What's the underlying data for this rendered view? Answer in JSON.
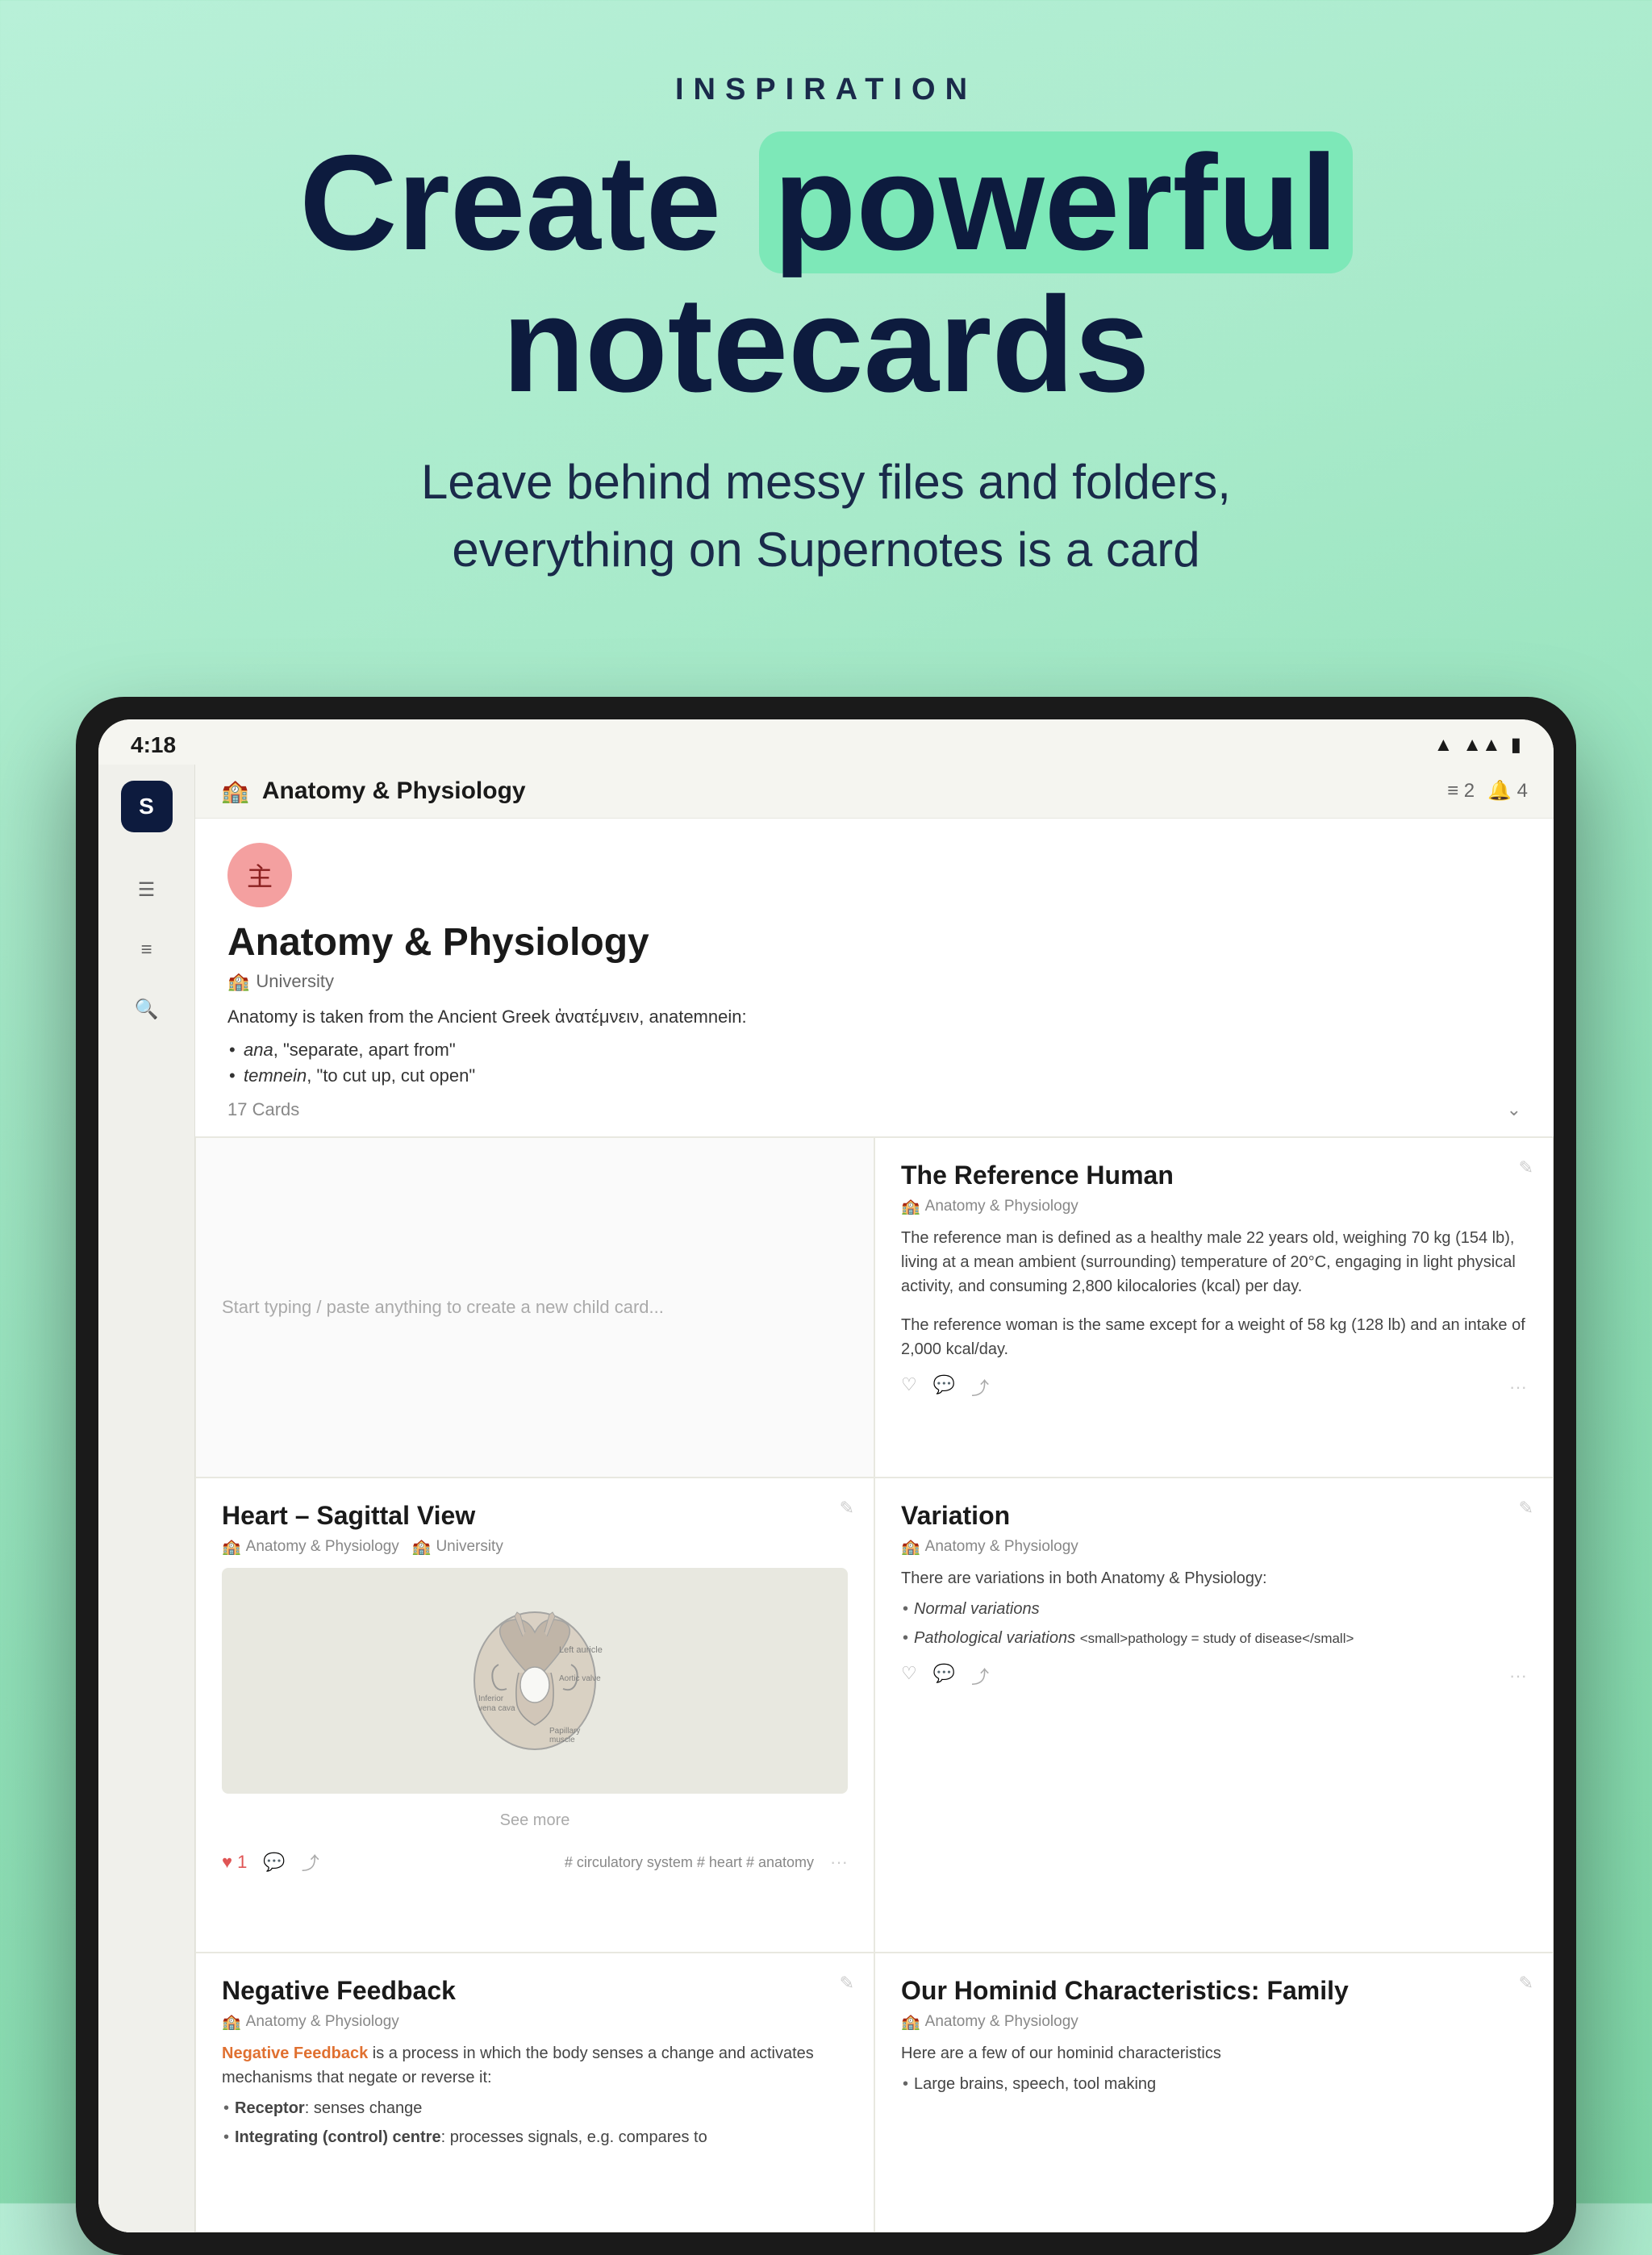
{
  "hero": {
    "inspiration": "INSPIRATION",
    "headline_start": "Create ",
    "headline_highlight": "powerful",
    "headline_end": "notecards",
    "subtitle_line1": "Leave behind messy files and folders,",
    "subtitle_line2": "everything on Supernotes is a card"
  },
  "status_bar": {
    "time": "4:18",
    "icons": "▶ ⬛ ⬛"
  },
  "top_bar": {
    "icon": "🏫",
    "title": "Anatomy & Physiology",
    "filter_count": "≡ 2",
    "bell_count": "🔔 4"
  },
  "card_header": {
    "avatar_icon": "主",
    "title": "Anatomy & Physiology",
    "subtitle": "University",
    "description": "Anatomy is taken from the Ancient Greek ἀνατέμνειν, anatemnein:",
    "bullets": [
      "ana, \"separate, apart from\"",
      "temnein, \"to cut up, cut open\""
    ],
    "cards_count": "17 Cards"
  },
  "cards": {
    "new_placeholder": "Start typing / paste anything to create a new child card...",
    "heart_card": {
      "title": "Heart – Sagittal View",
      "meta1": "Anatomy & Physiology",
      "meta2": "University",
      "see_more": "See more",
      "tags": "# circulatory system   # heart   # anatomy",
      "likes": "1"
    },
    "reference_human": {
      "title": "The Reference Human",
      "meta": "Anatomy & Physiology",
      "body1": "The reference man is defined as a healthy male 22 years old, weighing 70 kg (154 lb), living at a mean ambient (surrounding) temperature of 20°C, engaging in light physical activity, and consuming 2,800 kilocalories (kcal) per day.",
      "body2": "The reference woman is the same except for a weight of 58 kg (128 lb) and an intake of 2,000 kcal/day."
    },
    "variation": {
      "title": "Variation",
      "meta": "Anatomy & Physiology",
      "intro": "There are variations in both Anatomy & Physiology:",
      "bullets": [
        "Normal variations",
        "Pathological variations <small>pathology = study of disease</small>"
      ]
    },
    "negative_feedback": {
      "title": "Negative Feedback",
      "meta": "Anatomy & Physiology",
      "highlight": "Negative Feedback",
      "body": " is a process in which the body senses a change and activates mechanisms that negate or reverse it:",
      "bullets": [
        "<strong>Receptor</strong>: senses change",
        "<strong>Integrating (control) centre</strong>: processes signals, e.g. compares to"
      ]
    },
    "hominid": {
      "title": "Our Hominid Characteristics: Family",
      "meta": "Anatomy & Physiology",
      "intro": "Here are a few of our hominid characteristics",
      "bullets": [
        "Large brains, speech, tool making"
      ]
    }
  },
  "icons": {
    "sidebar_logo": "S",
    "menu": "≡",
    "search": "🔍",
    "edit": "✎",
    "heart": "♥",
    "comment": "💬",
    "share": "⤴",
    "more": "···",
    "expand": "⌄"
  }
}
